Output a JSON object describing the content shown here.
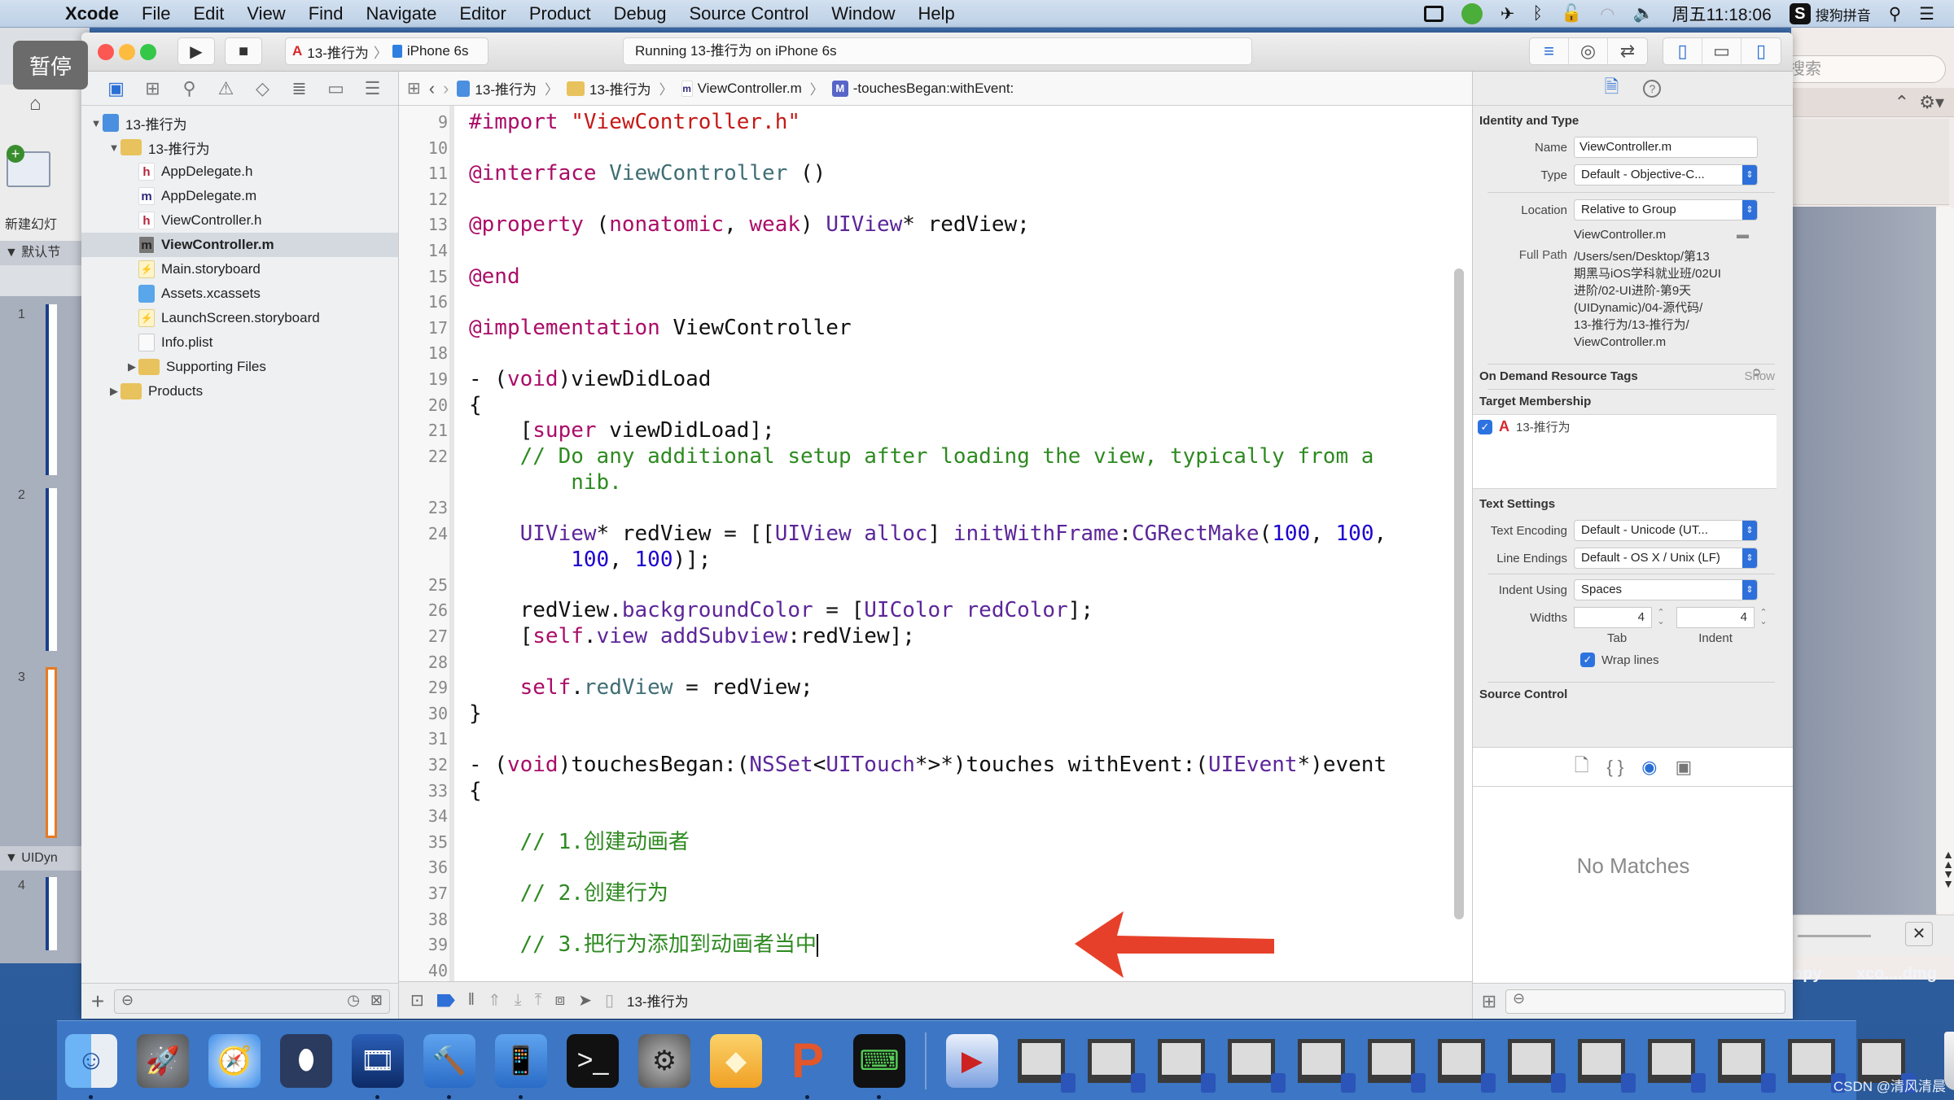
{
  "menubar": {
    "app": "Xcode",
    "items": [
      "File",
      "Edit",
      "View",
      "Find",
      "Navigate",
      "Editor",
      "Product",
      "Debug",
      "Source Control",
      "Window",
      "Help"
    ],
    "clock": "周五11:18:06",
    "input_method": "搜狗拼音"
  },
  "overlay": {
    "pause_label": "暂停"
  },
  "background_app": {
    "new_slide_label": "新建幻灯",
    "section1": "▼ 默认节",
    "section2": "▼ UIDyn",
    "slide_numbers": [
      "1",
      "2",
      "3",
      "4"
    ],
    "search_placeholder": "搜索",
    "desktop_items": [
      "opy",
      "xco....dmg"
    ]
  },
  "toolbar": {
    "scheme_target": "13-推行为",
    "scheme_device": "iPhone 6s",
    "activity_status": "Running 13-推行为 on iPhone 6s"
  },
  "navigator": {
    "tree": [
      {
        "label": "13-推行为",
        "kind": "proj",
        "depth": 0,
        "expanded": true
      },
      {
        "label": "13-推行为",
        "kind": "folder",
        "depth": 1,
        "expanded": true
      },
      {
        "label": "AppDelegate.h",
        "kind": "h",
        "depth": 2
      },
      {
        "label": "AppDelegate.m",
        "kind": "m",
        "depth": 2
      },
      {
        "label": "ViewController.h",
        "kind": "h",
        "depth": 2
      },
      {
        "label": "ViewController.m",
        "kind": "m",
        "depth": 2,
        "selected": true
      },
      {
        "label": "Main.storyboard",
        "kind": "sb",
        "depth": 2
      },
      {
        "label": "Assets.xcassets",
        "kind": "assets",
        "depth": 2
      },
      {
        "label": "LaunchScreen.storyboard",
        "kind": "sb",
        "depth": 2
      },
      {
        "label": "Info.plist",
        "kind": "plist",
        "depth": 2
      },
      {
        "label": "Supporting Files",
        "kind": "folder",
        "depth": 2,
        "collapsed": true
      },
      {
        "label": "Products",
        "kind": "folder",
        "depth": 1,
        "collapsed": true
      }
    ]
  },
  "jumpbar": {
    "crumbs": [
      "13-推行为",
      "13-推行为",
      "ViewController.m",
      "-touchesBegan:withEvent:"
    ]
  },
  "editor": {
    "lines": [
      {
        "n": "9",
        "y": 0,
        "html": "<span class=\"kw\">#import</span> <span class=\"str\">\"ViewController.h\"</span>"
      },
      {
        "n": "10",
        "y": 1,
        "html": ""
      },
      {
        "n": "11",
        "y": 2,
        "html": "<span class=\"kw\">@interface</span> <span class=\"cls\">ViewController</span> ()"
      },
      {
        "n": "12",
        "y": 3,
        "html": ""
      },
      {
        "n": "13",
        "y": 4,
        "html": "<span class=\"kw\">@property</span> (<span class=\"kw\">nonatomic</span>, <span class=\"kw\">weak</span>) <span class=\"typ\">UIView</span>* redView;"
      },
      {
        "n": "14",
        "y": 5,
        "html": ""
      },
      {
        "n": "15",
        "y": 6,
        "html": "<span class=\"kw\">@end</span>"
      },
      {
        "n": "16",
        "y": 7,
        "html": ""
      },
      {
        "n": "17",
        "y": 8,
        "html": "<span class=\"kw\">@implementation</span> ViewController"
      },
      {
        "n": "18",
        "y": 9,
        "html": ""
      },
      {
        "n": "19",
        "y": 10,
        "html": "- (<span class=\"kw\">void</span>)viewDidLoad"
      },
      {
        "n": "20",
        "y": 11,
        "html": "{"
      },
      {
        "n": "21",
        "y": 12,
        "html": "    [<span class=\"kw\">super</span> viewDidLoad];"
      },
      {
        "n": "22",
        "y": 13,
        "html": "    <span class=\"cmt\">// Do any additional setup after loading the view, typically from a</span>\n<span class=\"cmt\">        nib.</span>"
      },
      {
        "n": "23",
        "y": 15,
        "html": ""
      },
      {
        "n": "24",
        "y": 16,
        "html": "    <span class=\"typ\">UIView</span>* redView = [[<span class=\"typ\">UIView</span> <span class=\"typ\">alloc</span>] <span class=\"typ\">initWithFrame</span>:<span class=\"typ\">CGRectMake</span>(<span class=\"num\">100</span>, <span class=\"num\">100</span>,\n        <span class=\"num\">100</span>, <span class=\"num\">100</span>)];"
      },
      {
        "n": "25",
        "y": 18,
        "html": ""
      },
      {
        "n": "26",
        "y": 19,
        "html": "    redView.<span class=\"typ\">backgroundColor</span> = [<span class=\"typ\">UIColor</span> <span class=\"typ\">redColor</span>];"
      },
      {
        "n": "27",
        "y": 20,
        "html": "    [<span class=\"kw\">self</span>.<span class=\"typ\">view</span> <span class=\"typ\">addSubview</span>:redView];"
      },
      {
        "n": "28",
        "y": 21,
        "html": ""
      },
      {
        "n": "29",
        "y": 22,
        "html": "    <span class=\"kw\">self</span>.<span class=\"prop\">redView</span> = redView;"
      },
      {
        "n": "30",
        "y": 23,
        "html": "}"
      },
      {
        "n": "31",
        "y": 24,
        "html": ""
      },
      {
        "n": "32",
        "y": 25,
        "html": "- (<span class=\"kw\">void</span>)touchesBegan:(<span class=\"typ\">NSSet</span>&lt;<span class=\"typ\">UITouch</span>*&gt;*)touches withEvent:(<span class=\"typ\">UIEvent</span>*)event"
      },
      {
        "n": "33",
        "y": 26,
        "html": "{"
      },
      {
        "n": "34",
        "y": 27,
        "html": ""
      },
      {
        "n": "35",
        "y": 28,
        "html": "    <span class=\"cmt\">// 1.创建动画者</span>"
      },
      {
        "n": "36",
        "y": 29,
        "html": ""
      },
      {
        "n": "37",
        "y": 30,
        "html": "    <span class=\"cmt\">// 2.创建行为</span>"
      },
      {
        "n": "38",
        "y": 31,
        "html": ""
      },
      {
        "n": "39",
        "y": 32,
        "html": "    <span class=\"cmt\">// 3.把行为添加到动画者当中</span><span class=\"caret\"></span>"
      },
      {
        "n": "40",
        "y": 33,
        "html": ""
      }
    ]
  },
  "debugbar": {
    "target": "13-推行为"
  },
  "inspector": {
    "identity": {
      "title": "Identity and Type",
      "name_label": "Name",
      "name_value": "ViewController.m",
      "type_label": "Type",
      "type_value": "Default - Objective-C...",
      "location_label": "Location",
      "location_value": "Relative to Group",
      "relative_file": "ViewController.m",
      "fullpath_label": "Full Path",
      "fullpath_lines": [
        "/Users/sen/Desktop/第13",
        "期黑马iOS学科就业班/02UI",
        "进阶/02-UI进阶-第9天",
        "(UIDynamic)/04-源代码/",
        "13-推行为/13-推行为/",
        "ViewController.m"
      ]
    },
    "odr": {
      "title": "On Demand Resource Tags",
      "action": "Show"
    },
    "membership": {
      "title": "Target Membership",
      "target": "13-推行为",
      "checked": true
    },
    "text_settings": {
      "title": "Text Settings",
      "encoding_label": "Text Encoding",
      "encoding_value": "Default - Unicode (UT...",
      "endings_label": "Line Endings",
      "endings_value": "Default - OS X / Unix (LF)",
      "indent_label": "Indent Using",
      "indent_value": "Spaces",
      "widths_label": "Widths",
      "tab_width": "4",
      "indent_width": "4",
      "tab_caption": "Tab",
      "indent_caption": "Indent",
      "wrap_label": "Wrap lines",
      "wrap_checked": true
    },
    "source_control": {
      "title": "Source Control"
    },
    "library": {
      "empty_text": "No Matches"
    }
  },
  "dock": {
    "apps": [
      "finder",
      "launchpad",
      "safari",
      "mouse",
      "photo-booth",
      "xcode",
      "simulator",
      "terminal",
      "system-preferences",
      "sketch",
      "powerpoint",
      "console"
    ],
    "vm_count": 13
  },
  "watermark": "CSDN @清风清晨"
}
